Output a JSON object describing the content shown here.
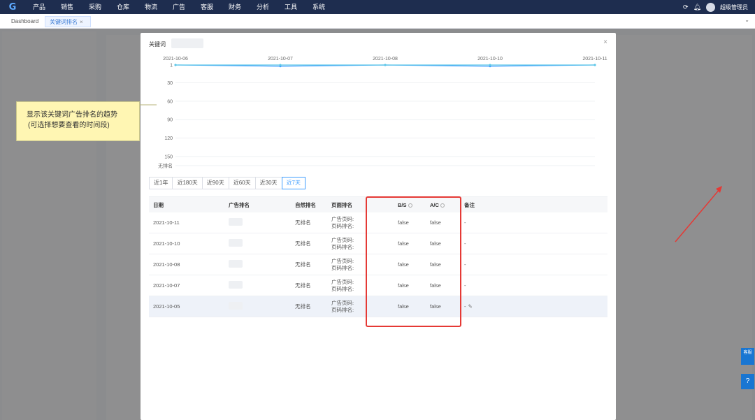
{
  "nav": {
    "logo": "G",
    "menu": [
      "产品",
      "销售",
      "采购",
      "仓库",
      "物流",
      "广告",
      "客服",
      "财务",
      "分析",
      "工具",
      "系统"
    ],
    "user": "超级管理员"
  },
  "tabs": {
    "dashboard": "Dashboard",
    "active": "关键词排名",
    "close": "×",
    "dropdown": "⌄"
  },
  "modal": {
    "title": "关键词",
    "close": "×"
  },
  "chart_data": {
    "type": "line",
    "x": [
      "2021-10-06",
      "2021-10-07",
      "2021-10-08",
      "2021-10-10",
      "2021-10-11"
    ],
    "y_ticks": [
      "1",
      "30",
      "60",
      "90",
      "120",
      "150",
      "无排名"
    ],
    "series": [
      {
        "values": [
          1,
          3,
          1,
          3,
          1
        ]
      },
      {
        "values": [
          1,
          1,
          1,
          1,
          1
        ]
      }
    ],
    "ylim": [
      1,
      165
    ],
    "y_inverted": true,
    "colors": [
      "#409eff",
      "#5cc8e6"
    ],
    "grid": true
  },
  "ranges": [
    "近1年",
    "近180天",
    "近90天",
    "近60天",
    "近30天",
    "近7天"
  ],
  "active_range": "近7天",
  "table": {
    "headers": {
      "date": "日期",
      "ad": "广告排名",
      "natural": "自然排名",
      "page": "页面排名",
      "bs": "B/S",
      "ac": "A/C",
      "note": "备注"
    },
    "rows": [
      {
        "date": "2021-10-11",
        "natural": "无排名",
        "page1": "广告页码:",
        "page2": "页码排名:",
        "bs": "false",
        "ac": "false",
        "note": "-"
      },
      {
        "date": "2021-10-10",
        "natural": "无排名",
        "page1": "广告页码:",
        "page2": "页码排名:",
        "bs": "false",
        "ac": "false",
        "note": "-"
      },
      {
        "date": "2021-10-08",
        "natural": "无排名",
        "page1": "广告页码:",
        "page2": "页码排名:",
        "bs": "false",
        "ac": "false",
        "note": "-"
      },
      {
        "date": "2021-10-07",
        "natural": "无排名",
        "page1": "广告页码:",
        "page2": "页码排名:",
        "bs": "false",
        "ac": "false",
        "note": "-"
      },
      {
        "date": "2021-10-05",
        "natural": "无排名",
        "page1": "广告页码:",
        "page2": "页码排名:",
        "bs": "false",
        "ac": "false",
        "note": "-"
      }
    ]
  },
  "callout": {
    "line1": "显示该关键词广告排名的趋势",
    "line2": "(可选择想要查看的时间段)"
  },
  "floats": {
    "service": "客服",
    "help": "?"
  },
  "colors": {
    "nav_bg": "#1e2d4f",
    "accent": "#409eff",
    "highlight": "#e53935",
    "callout_bg": "#fff6b3"
  }
}
